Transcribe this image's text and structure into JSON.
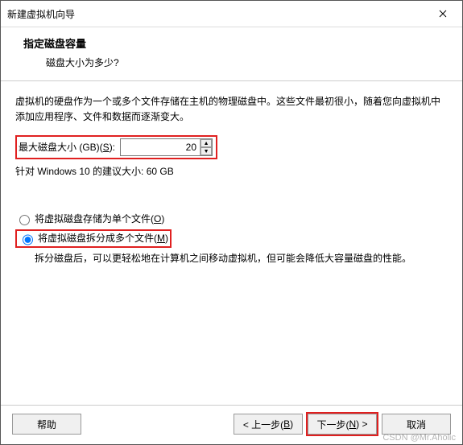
{
  "window": {
    "title": "新建虚拟机向导"
  },
  "header": {
    "title": "指定磁盘容量",
    "subtitle": "磁盘大小为多少?"
  },
  "body": {
    "desc": "虚拟机的硬盘作为一个或多个文件存储在主机的物理磁盘中。这些文件最初很小，随着您向虚拟机中添加应用程序、文件和数据而逐渐变大。",
    "size_label_pre": "最大磁盘大小 (GB)(",
    "size_label_key": "S",
    "size_label_post": "):",
    "size_value": "20",
    "recommendation": "针对 Windows 10 的建议大小: 60 GB",
    "radio_single_pre": "将虚拟磁盘存储为单个文件(",
    "radio_single_key": "O",
    "radio_single_post": ")",
    "radio_split_pre": "将虚拟磁盘拆分成多个文件(",
    "radio_split_key": "M",
    "radio_split_post": ")",
    "split_desc": "拆分磁盘后，可以更轻松地在计算机之间移动虚拟机，但可能会降低大容量磁盘的性能。"
  },
  "footer": {
    "help": "帮助",
    "back_pre": "< 上一步(",
    "back_key": "B",
    "back_post": ")",
    "next_pre": "下一步(",
    "next_key": "N",
    "next_post": ") >",
    "cancel": "取消"
  },
  "watermark": "CSDN @Mr.Aholic"
}
